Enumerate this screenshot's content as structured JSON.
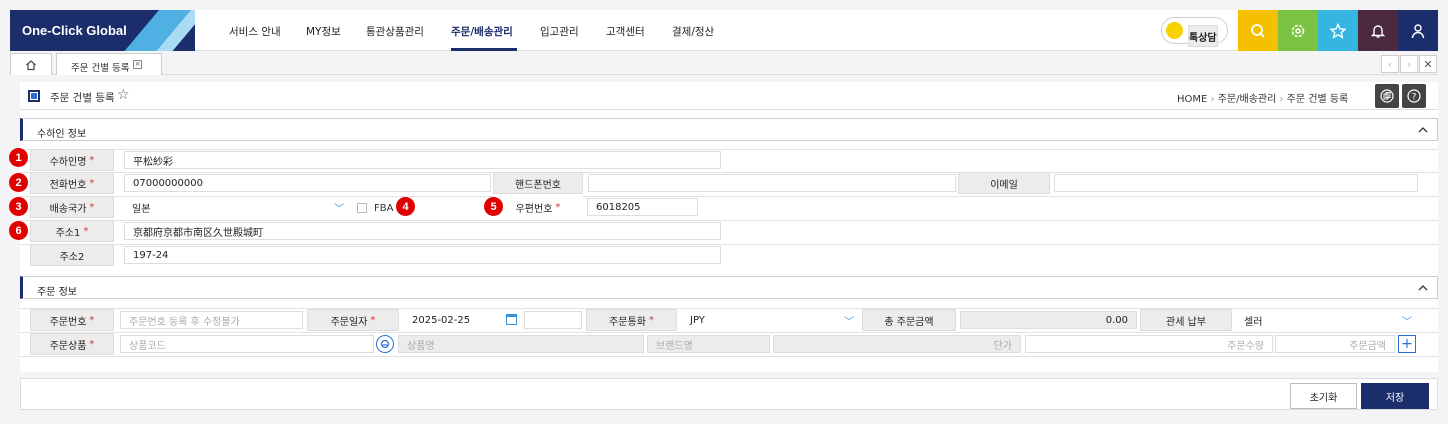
{
  "app": {
    "logo": "One-Click Global"
  },
  "nav": {
    "items": [
      "서비스 안내",
      "MY정보",
      "통관상품관리",
      "주문/배송관리",
      "입고관리",
      "고객센터",
      "결제/정산"
    ],
    "active_index": 3
  },
  "header": {
    "kakao_label": "톡상담",
    "colors": {
      "brand": "#1b2d6b",
      "search": "#f5c000",
      "settings": "#7cc242",
      "favorite": "#35b6e0",
      "notice": "#4b2a40",
      "user": "#1b2d6b"
    }
  },
  "tabs": {
    "open": [
      "주문 건별 등록"
    ]
  },
  "page": {
    "title": "주문 건별 등록",
    "breadcrumb": [
      "HOME",
      "주문/배송관리",
      "주문 건별 등록"
    ]
  },
  "recipient": {
    "section_title": "수하인 정보",
    "name_label": "수하인명",
    "name_value": "平松紗彩",
    "phone_label": "전화번호",
    "phone_value": "07000000000",
    "mobile_label": "핸드폰번호",
    "mobile_value": "",
    "email_label": "이메일",
    "email_value": "",
    "country_label": "배송국가",
    "country_value": "일본",
    "fba_label": "FBA",
    "zip_label": "우편번호",
    "zip_value": "6018205",
    "addr1_label": "주소1",
    "addr1_value": "京都府京都市南区久世殿城町",
    "addr2_label": "주소2",
    "addr2_value": "197-24"
  },
  "order": {
    "section_title": "주문 정보",
    "order_no_label": "주문번호",
    "order_no_placeholder": "주문번호 등록 후 수정불가",
    "order_date_label": "주문일자",
    "order_date_value": "2025-02-25",
    "currency_label": "주문통화",
    "currency_value": "JPY",
    "total_label": "총 주문금액",
    "total_value": "0.00",
    "duty_label": "관세 납부",
    "duty_value": "셀러",
    "product_label": "주문상품",
    "product_code_placeholder": "상품코드",
    "product_name_placeholder": "상품명",
    "brand_placeholder": "브랜드명",
    "unit_price_placeholder": "단가",
    "qty_placeholder": "주문수량",
    "amount_placeholder": "주문금액"
  },
  "badges": [
    "1",
    "2",
    "3",
    "4",
    "5",
    "6"
  ],
  "footer": {
    "reset_label": "초기화",
    "save_label": "저장"
  }
}
